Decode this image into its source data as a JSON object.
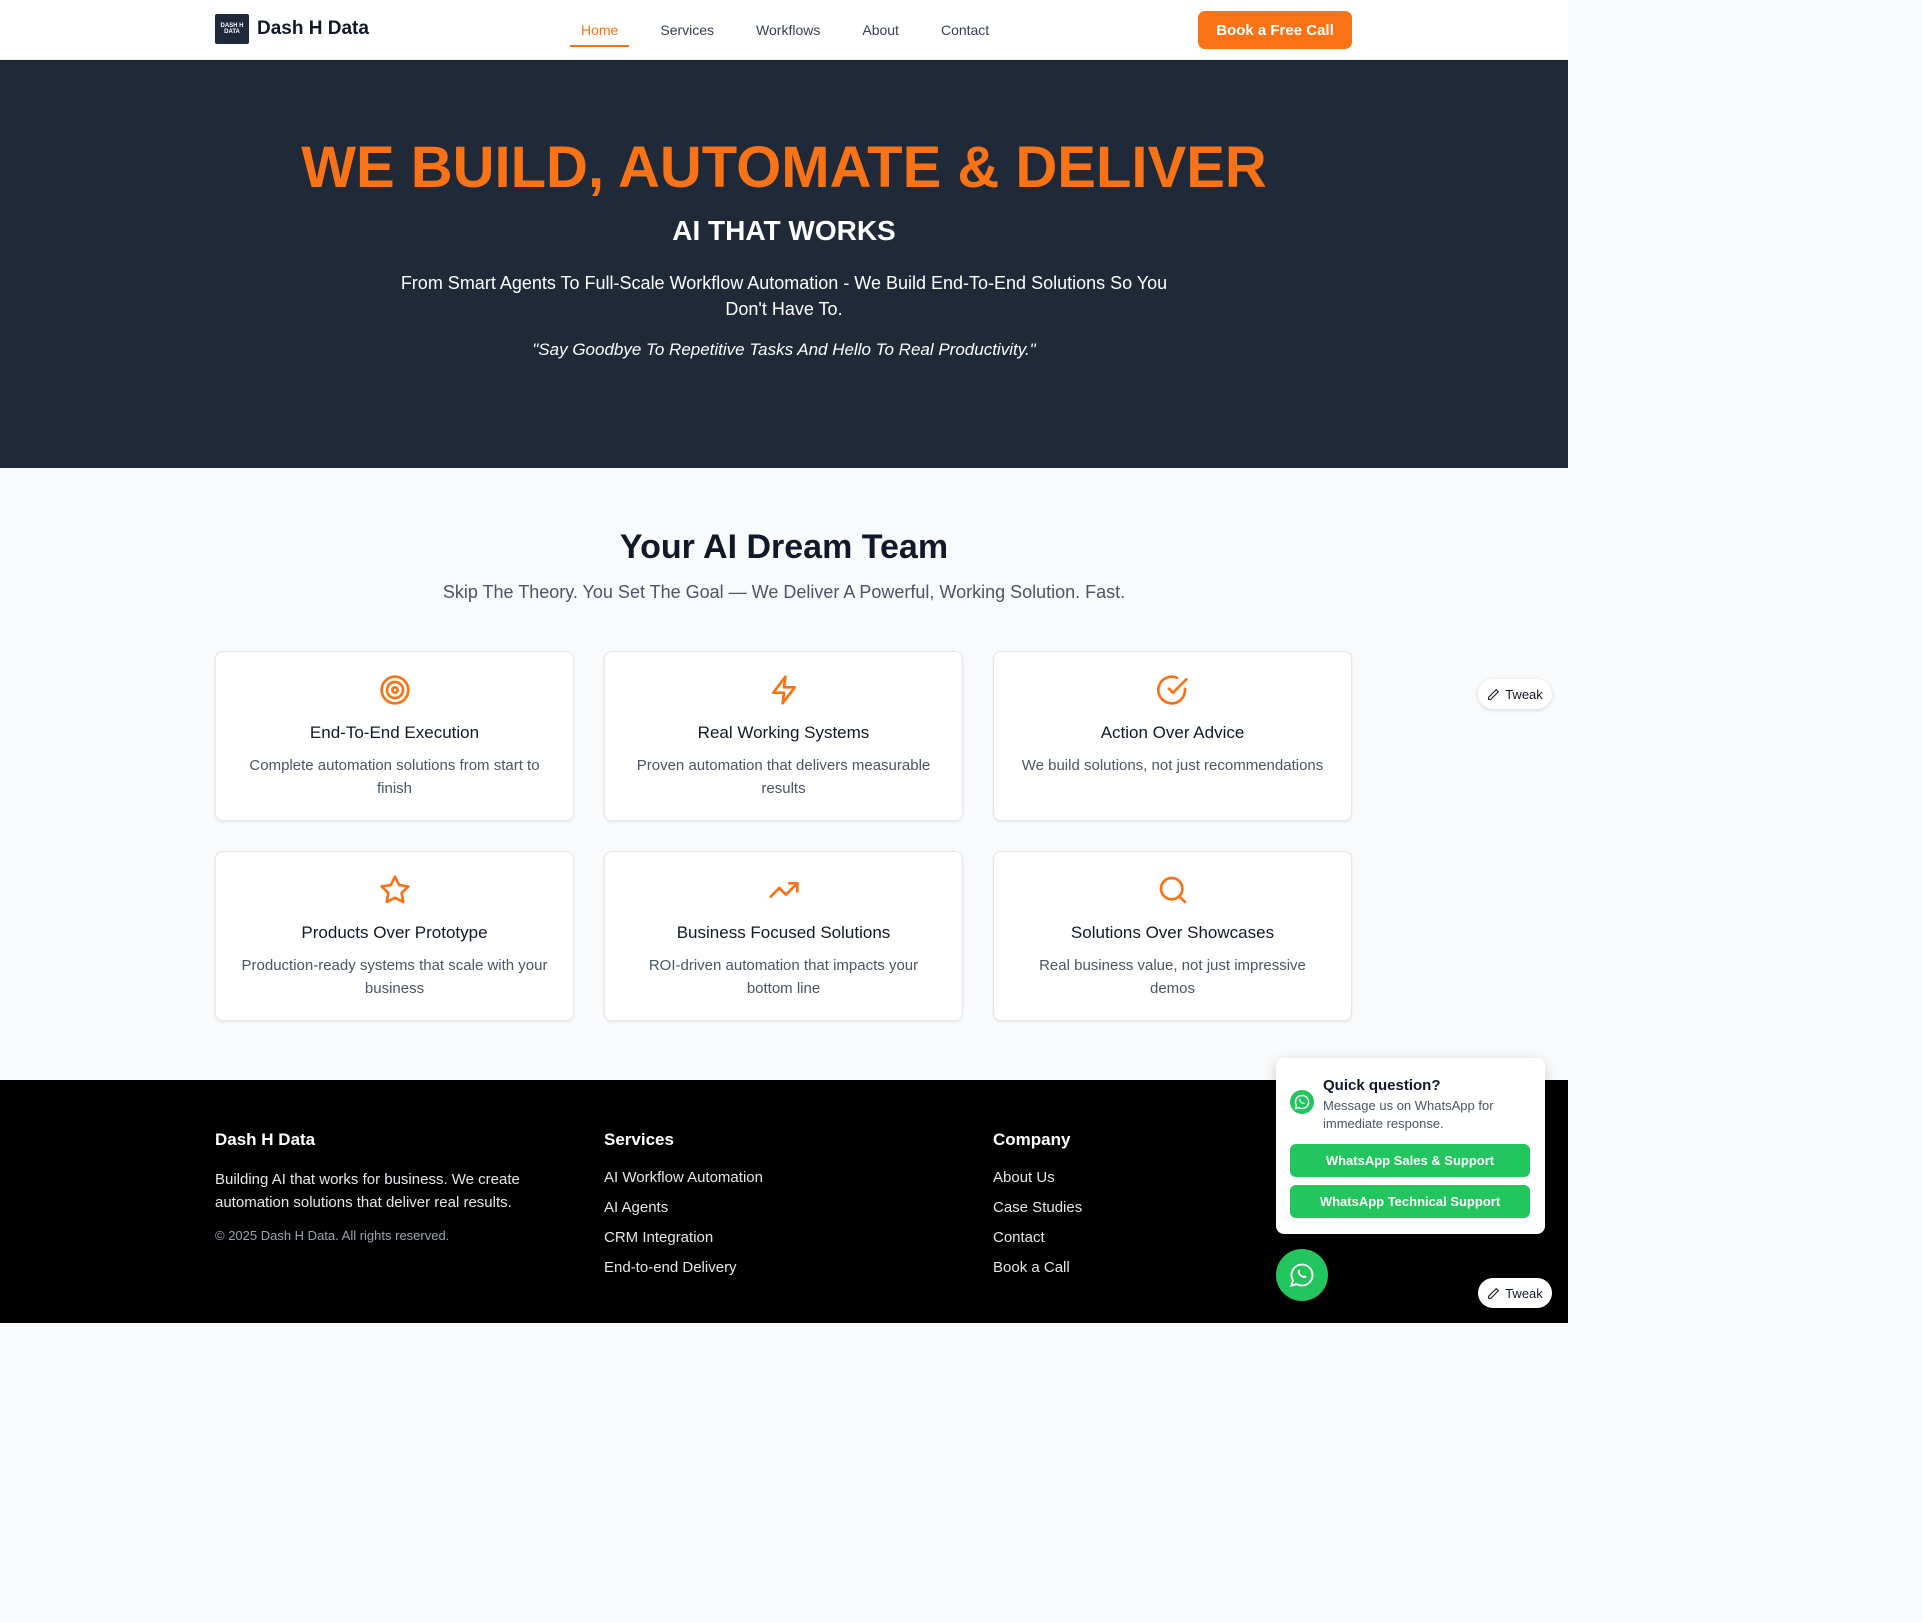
{
  "nav": {
    "logo_mark": "DASH H DATA",
    "brand": "Dash H Data",
    "links": [
      "Home",
      "Services",
      "Workflows",
      "About",
      "Contact"
    ],
    "active": "Home",
    "cta": "Book a Free Call"
  },
  "hero": {
    "title": "WE BUILD, AUTOMATE & DELIVER",
    "subtitle": "AI THAT WORKS",
    "description": "From Smart Agents To Full-Scale Workflow Automation - We Build End-To-End Solutions So You Don't Have To.",
    "quote": "\"Say Goodbye To Repetitive Tasks And Hello To Real Productivity.\""
  },
  "team": {
    "title": "Your AI Dream Team",
    "subtitle": "Skip The Theory. You Set The Goal — We Deliver A Powerful, Working Solution. Fast.",
    "cards": [
      {
        "icon": "target-icon",
        "title": "End-To-End Execution",
        "desc": "Complete automation solutions from start to finish"
      },
      {
        "icon": "lightning-icon",
        "title": "Real Working Systems",
        "desc": "Proven automation that delivers measurable results"
      },
      {
        "icon": "check-circle-icon",
        "title": "Action Over Advice",
        "desc": "We build solutions, not just recommendations"
      },
      {
        "icon": "star-icon",
        "title": "Products Over Prototype",
        "desc": "Production-ready systems that scale with your business"
      },
      {
        "icon": "trending-up-icon",
        "title": "Business Focused Solutions",
        "desc": "ROI-driven automation that impacts your bottom line"
      },
      {
        "icon": "search-icon",
        "title": "Solutions Over Showcases",
        "desc": "Real business value, not just impressive demos"
      }
    ]
  },
  "footer": {
    "brand": "Dash H Data",
    "desc": "Building AI that works for business. We create automation solutions that deliver real results.",
    "copyright": "© 2025 Dash H Data. All rights reserved.",
    "services_title": "Services",
    "services": [
      "AI Workflow Automation",
      "AI Agents",
      "CRM Integration",
      "End-to-end Delivery"
    ],
    "company_title": "Company",
    "company": [
      "About Us",
      "Case Studies",
      "Contact",
      "Book a Call"
    ]
  },
  "whatsapp": {
    "title": "Quick question?",
    "desc": "Message us on WhatsApp for immediate response.",
    "btn_sales": "WhatsApp Sales & Support",
    "btn_tech": "WhatsApp Technical Support"
  },
  "tweak_label": "Tweak",
  "colors": {
    "accent": "#f97316",
    "hero_bg": "#1f2937",
    "whatsapp": "#22c55e"
  }
}
